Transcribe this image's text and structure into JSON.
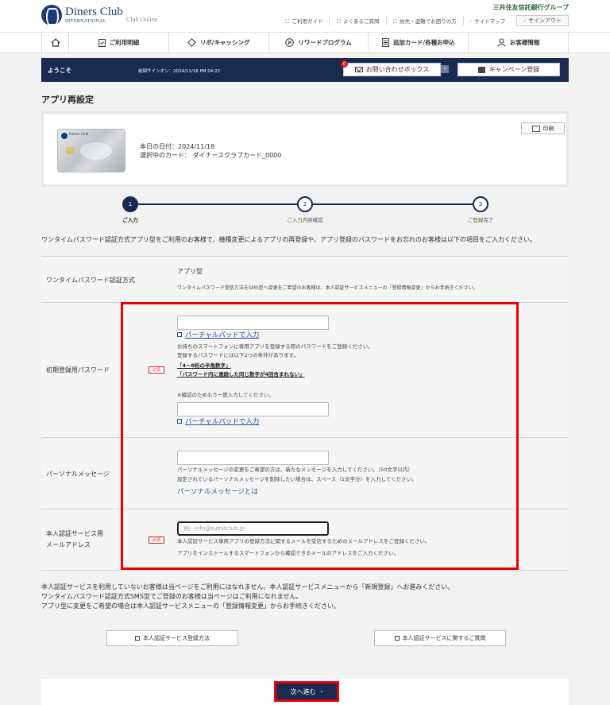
{
  "header": {
    "brand": "Diners Club",
    "brand_sub": "INTERNATIONAL",
    "brand_online": "Club Online",
    "group": "三井住友信託銀行グループ",
    "links": [
      "ご利用ガイド",
      "よくあるご質問",
      "紛失・盗難でお困りの方",
      "サイトマップ"
    ],
    "logout": "サインアウト"
  },
  "nav": {
    "items": [
      "ご利用明細",
      "リボ/キャッシング",
      "リワードプログラム",
      "追加カード/各種お申込",
      "お客様情報"
    ]
  },
  "welcome": {
    "hello": "ようこそ",
    "last_signin": "前回サインオン：2024/11/18 PM 04:22",
    "inbox": "お問い合わせボックス",
    "inbox_badge": "0",
    "inbox_count": "?",
    "campaign": "キャンペーン登録"
  },
  "page": {
    "title": "アプリ再設定",
    "print": "印刷",
    "date_line": "本日の日付：2024/11/18",
    "card_line": "選択中のカード： ダイナースクラブカード_0000"
  },
  "steps": [
    {
      "num": "1",
      "label": "ご入力"
    },
    {
      "num": "2",
      "label": "ご入力内容確認"
    },
    {
      "num": "3",
      "label": "ご登録完了"
    }
  ],
  "intro": "ワンタイムパスワード認証方式アプリ型をご利用のお客様で、機種変更によるアプリの再登録や、アプリ登録のパスワードをお忘れのお客様は以下の項目をご入力ください。",
  "form": {
    "required": "必須",
    "otp": {
      "label": "ワンタイムパスワード認証方式",
      "value": "アプリ型",
      "note": "ワンタイムパスワード受信方法をSMS型へ変更をご希望のお客様は、本人認証サービスメニューの「登録情報変更」からお手続きください。"
    },
    "password": {
      "label": "初期登録用パスワード",
      "vpad": "バーチャルパッドで入力",
      "desc1": "お持ちのスマートフォンに専用アプリを登録する際のパスワードをご登録ください。",
      "desc2": "登録するパスワードには以下2つの条件があります。",
      "cond1": "「4～8桁の半角数字」",
      "cond2": "「パスワード内に連続した同じ数字が4回含まれない」",
      "confirm": "※確認のためもう一度入力してください。",
      "vpad2": "バーチャルパッドで入力"
    },
    "personal": {
      "label": "パーソナルメッセージ",
      "desc1": "パーソナルメッセージの変更をご希望の方は、新たなメッセージを入力してください。（50文字以内）",
      "desc2": "設定されているパーソナルメッセージを削除したい場合は、スペース（1文字分）を入力してください。",
      "link": "パーソナルメッセージとは"
    },
    "email": {
      "label1": "本人認証サービス用",
      "label2": "メールアドレス",
      "placeholder": "例）info@sumitclub.jp",
      "desc1": "本人認証サービス専用アプリの登録方法に関するメールを受信するためのメールアドレスをご登録ください。",
      "desc2": "アプリをインストールするスマートフォンから確認できるメールのアドレスをご入力ください。"
    }
  },
  "footer": {
    "notes": [
      "本人認証サービスを利用していないお客様は当ページをご利用にはなれません。本人認証サービスメニューから「新規登録」へお進みください。",
      "ワンタイムパスワード認証方式SMS型でご登録のお客様は当ページはご利用になれません。",
      "アプリ型に変更をご希望の場合は本人認証サービスメニューの「登録情報変更」からお手続きください。"
    ],
    "btn_register": "本人認証サービス登録方法",
    "btn_faq": "本人認証サービスに関するご質問",
    "next": "次へ進む"
  }
}
